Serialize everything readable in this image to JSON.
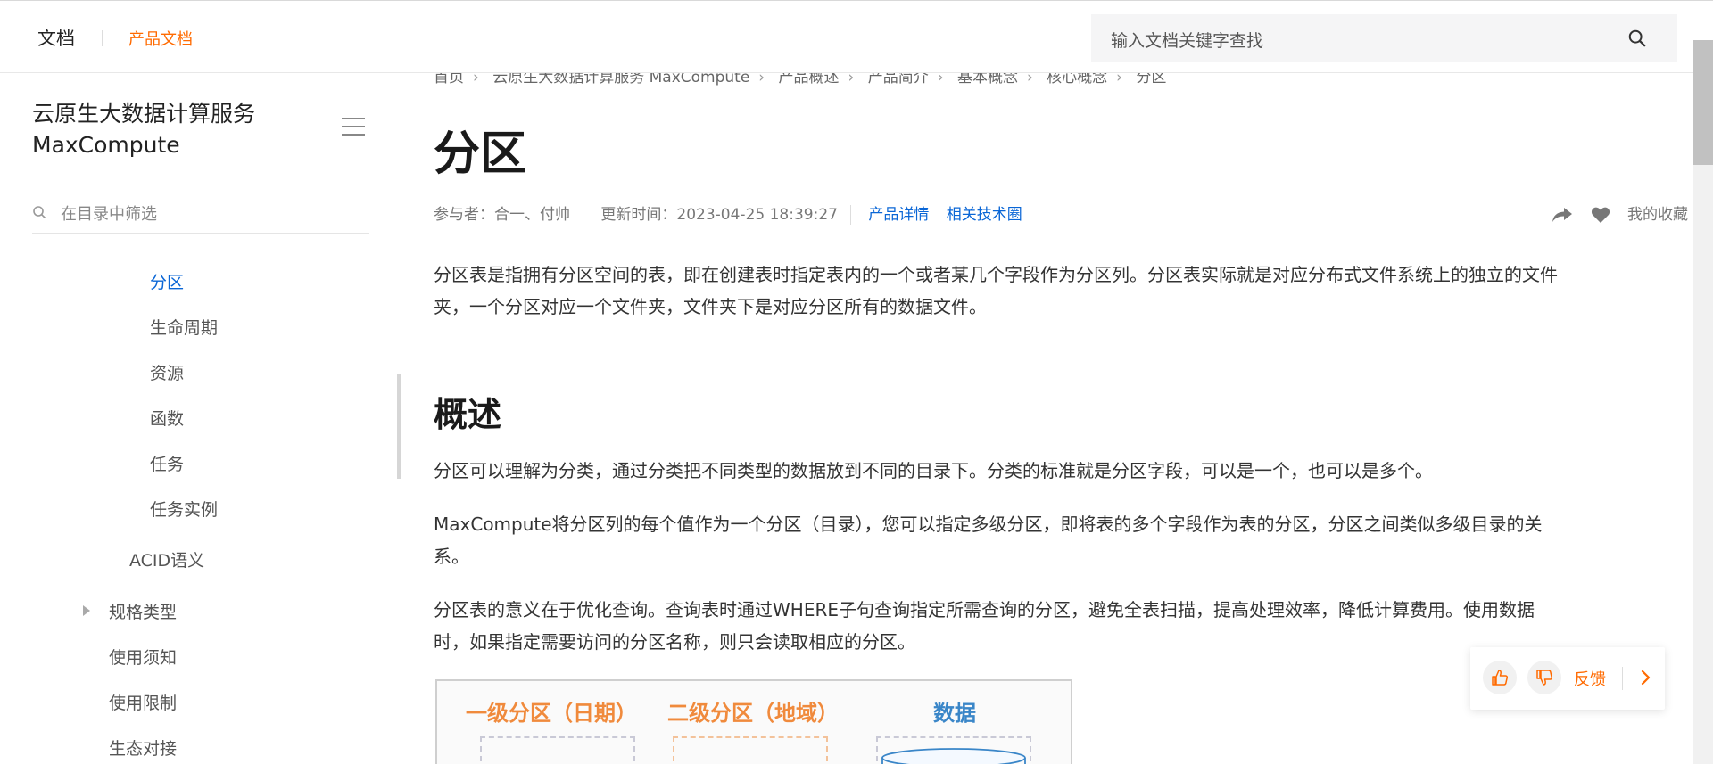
{
  "topbar": {
    "docs_label": "文档",
    "product_docs_label": "产品文档",
    "search_placeholder": "输入文档关键字查找"
  },
  "sidebar": {
    "title_line1": "云原生大数据计算服务",
    "title_line2": "MaxCompute",
    "filter_placeholder": "在目录中筛选",
    "items": [
      {
        "label": "分区",
        "active": true
      },
      {
        "label": "生命周期"
      },
      {
        "label": "资源"
      },
      {
        "label": "函数"
      },
      {
        "label": "任务"
      },
      {
        "label": "任务实例"
      },
      {
        "label": "ACID语义"
      },
      {
        "label": "规格类型",
        "expandable": true
      },
      {
        "label": "使用须知"
      },
      {
        "label": "使用限制"
      },
      {
        "label": "生态对接"
      }
    ]
  },
  "breadcrumb": [
    "首页",
    "云原生大数据计算服务 MaxCompute",
    "产品概述",
    "产品简介",
    "基本概念",
    "核心概念",
    "分区"
  ],
  "article": {
    "title": "分区",
    "participants": "参与者：合一、付帅",
    "updated": "更新时间：2023-04-25 18:39:27",
    "link_details": "产品详情",
    "link_circle": "相关技术圈",
    "favorite": "我的收藏",
    "intro_line1": "分区表是指拥有分区空间的表，即在创建表时指定表内的一个或者某几个字段作为分区列。分区表实际就是对应分布式文件系统上的独立的文件",
    "intro_line2": "夹，一个分区对应一个文件夹，文件夹下是对应分区所有的数据文件。",
    "section_title": "概述",
    "p1": "分区可以理解为分类，通过分类把不同类型的数据放到不同的目录下。分类的标准就是分区字段，可以是一个，也可以是多个。",
    "p2_line1": "MaxCompute将分区列的每个值作为一个分区（目录），您可以指定多级分区，即将表的多个字段作为表的分区，分区之间类似多级目录的关",
    "p2_line2": "系。",
    "p3_line1": "分区表的意义在于优化查询。查询表时通过WHERE子句查询指定所需查询的分区，避免全表扫描，提高处理效率，降低计算费用。使用数据",
    "p3_line2": "时，如果指定需要访问的分区名称，则只会读取相应的分区。"
  },
  "diagram": {
    "label1": "一级分区（日期）",
    "label2": "二级分区（地域）",
    "label3": "数据",
    "color_orange": "#f08a3c",
    "color_blue": "#3a86c8"
  },
  "feedback": {
    "label": "反馈"
  },
  "colors": {
    "accent": "#ff6a00",
    "link": "#0a66d6"
  }
}
